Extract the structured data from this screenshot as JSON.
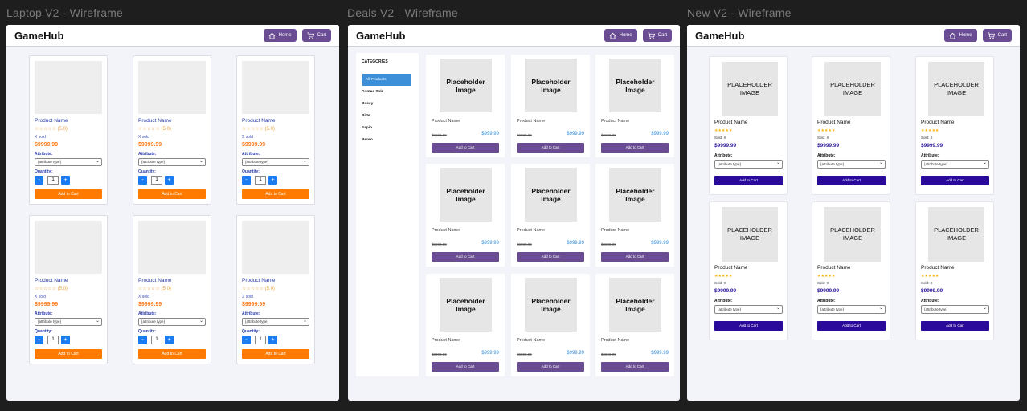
{
  "frames": {
    "laptop": {
      "label": "Laptop V2 - Wireframe",
      "logo": "GameHub",
      "home": "Home",
      "cart": "Cart"
    },
    "deals": {
      "label": "Deals V2 - Wireframe",
      "logo": "GameHub",
      "home": "Home",
      "cart": "Cart"
    },
    "new": {
      "label": "New V2 - Wireframe",
      "logo": "GameHub",
      "home": "Home",
      "cart": "Cart"
    }
  },
  "laptop_card": {
    "name": "Product Name",
    "stars": "☆☆☆☆☆ (5.0)",
    "sold": "X sold",
    "price": "$9999.99",
    "attribute_label": "Attribute:",
    "attribute_value": "{attribute type}",
    "quantity_label": "Quantity:",
    "minus": "-",
    "qty": "1",
    "plus": "+",
    "add": "Add to Cart"
  },
  "deals": {
    "categories_title": "CATEGORIES",
    "categories": [
      "All Products",
      "Games Sale",
      "Bussy",
      "Bitte",
      "Espin",
      "Benro"
    ],
    "card": {
      "placeholder": "Placeholder Image",
      "name": "Product Name",
      "old_price": "$9999.99",
      "new_price": "$999.99",
      "add": "Add to Cart"
    }
  },
  "new_card": {
    "placeholder": "PLACEHOLDER IMAGE",
    "name": "Product Name",
    "stars": "★★★★★",
    "sold": "Sold: X",
    "price": "$9999.99",
    "attribute_label": "Attribute:",
    "attribute_value": "{attribute type}",
    "add": "Add to Cart"
  }
}
